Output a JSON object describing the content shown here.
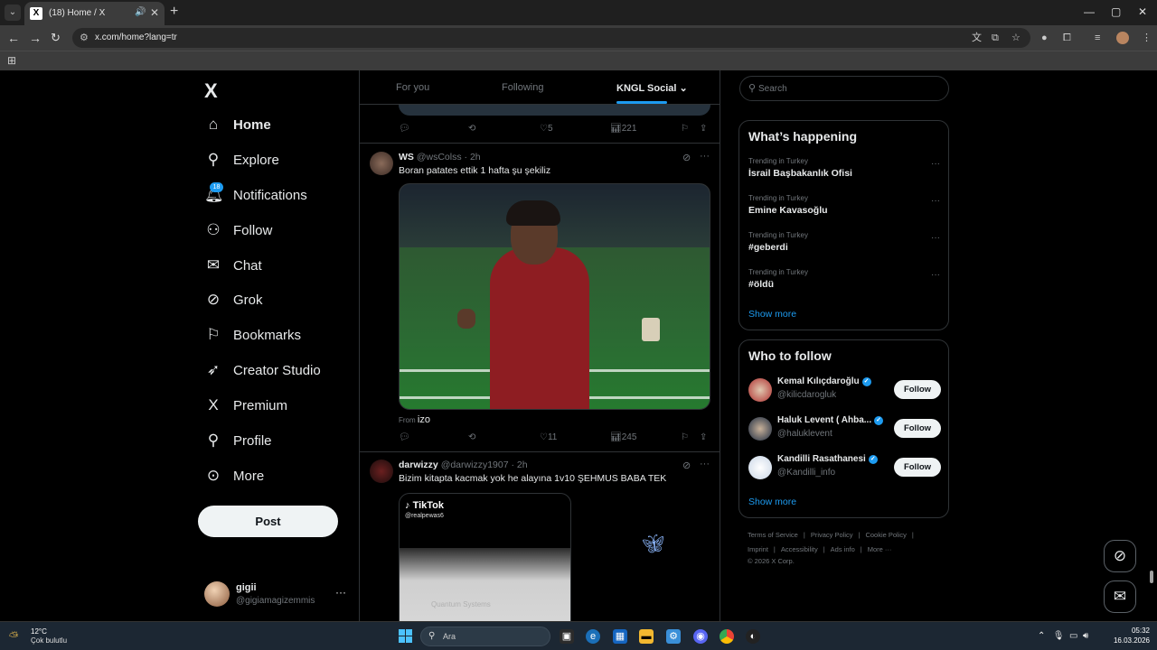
{
  "browser": {
    "tab_title": "(18) Home / X",
    "tab_favicon": "X",
    "url": "x.com/home?lang=tr",
    "window_controls": [
      "—",
      "▢",
      "✕"
    ]
  },
  "sidebar": {
    "logo": "X",
    "items": [
      {
        "label": "Home",
        "icon": "home-icon"
      },
      {
        "label": "Explore",
        "icon": "search-icon"
      },
      {
        "label": "Notifications",
        "icon": "bell-icon",
        "badge": "18"
      },
      {
        "label": "Follow",
        "icon": "person-add-icon"
      },
      {
        "label": "Chat",
        "icon": "mail-icon"
      },
      {
        "label": "Grok",
        "icon": "grok-icon"
      },
      {
        "label": "Bookmarks",
        "icon": "bookmark-icon"
      },
      {
        "label": "Creator Studio",
        "icon": "rocket-icon"
      },
      {
        "label": "Premium",
        "icon": "x-icon"
      },
      {
        "label": "Profile",
        "icon": "person-icon"
      },
      {
        "label": "More",
        "icon": "more-circle-icon"
      }
    ],
    "post_label": "Post",
    "account": {
      "name": "gigii",
      "handle": "@gigiamagizemmis"
    }
  },
  "feed": {
    "tabs": [
      "For you",
      "Following",
      "KNGL Social"
    ],
    "active_tab": "KNGL Social",
    "prev_actions": {
      "likes": "5",
      "views": "221"
    },
    "tweets": [
      {
        "name": "WS",
        "handle": "@wsColss",
        "time": "2h",
        "text": "Boran patates ettik 1 hafta şu şekiliz",
        "from_label": "From",
        "from_source": "izo",
        "likes": "11",
        "views": "245"
      },
      {
        "name": "darwizzy",
        "handle": "@darwizzy1907",
        "time": "2h",
        "text": "Bizim kitapta kacmak yok he alayına 1v10 ŞEHMUS BABA TEK",
        "media_brand": "TikTok",
        "media_handle": "@realpewas6",
        "media_text": "Quantum Systems"
      }
    ]
  },
  "right": {
    "search_placeholder": "Search",
    "happening": {
      "title": "What’s happening",
      "trends": [
        {
          "context": "Trending in Turkey",
          "topic": "İsrail Başbakanlık Ofisi"
        },
        {
          "context": "Trending in Turkey",
          "topic": "Emine Kavasoğlu"
        },
        {
          "context": "Trending in Turkey",
          "topic": "#geberdi"
        },
        {
          "context": "Trending in Turkey",
          "topic": "#öldü"
        }
      ],
      "show_more": "Show more"
    },
    "who_to_follow": {
      "title": "Who to follow",
      "accounts": [
        {
          "name": "Kemal Kılıçdaroğlu",
          "handle": "@kilicdarogluk",
          "button": "Follow"
        },
        {
          "name": "Haluk Levent ( Ahba...",
          "handle": "@haluklevent",
          "button": "Follow"
        },
        {
          "name": "Kandilli Rasathanesi",
          "handle": "@Kandilli_info",
          "button": "Follow"
        }
      ],
      "show_more": "Show more"
    },
    "footer": {
      "line1": [
        "Terms of Service",
        "|",
        "Privacy Policy",
        "|",
        "Cookie Policy",
        "|"
      ],
      "line2": [
        "Imprint",
        "|",
        "Accessibility",
        "|",
        "Ads info",
        "|",
        "More ···"
      ],
      "copyright": "© 2026 X Corp."
    }
  },
  "taskbar": {
    "temp": "12°C",
    "weather": "Çok bulutlu",
    "search_placeholder": "Ara",
    "time": "05:32",
    "date": "16.03.2026"
  },
  "colors": {
    "accent": "#1d9bf0",
    "background": "#000000",
    "border": "#2f3336",
    "muted": "#71767b"
  }
}
